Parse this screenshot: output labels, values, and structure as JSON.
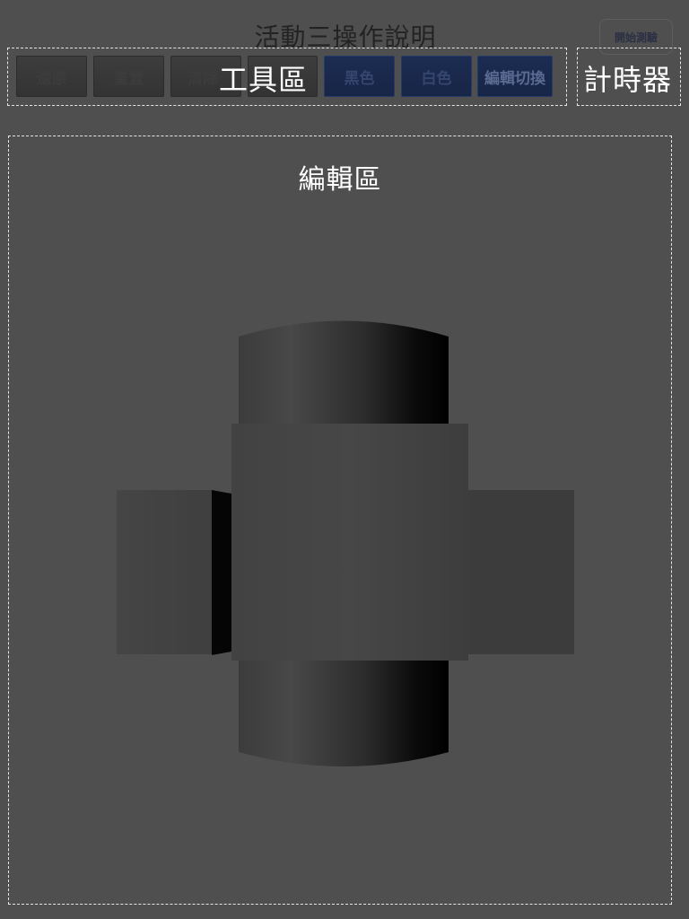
{
  "header": {
    "title": "活動三操作說明",
    "start_button": "開始測驗"
  },
  "toolbar": {
    "label": "工具區",
    "buttons": [
      {
        "label": "還原",
        "state": "disabled"
      },
      {
        "label": "重置",
        "state": "disabled"
      },
      {
        "label": "清除",
        "state": "disabled"
      },
      {
        "label": "",
        "state": "disabled"
      },
      {
        "label": "黑色",
        "state": "enabled"
      },
      {
        "label": "白色",
        "state": "enabled"
      },
      {
        "label": "編輯切換",
        "state": "enabled"
      }
    ]
  },
  "timer": {
    "label": "計時器"
  },
  "editor": {
    "label": "編輯區"
  },
  "colors": {
    "background": "#4f4f4f",
    "dashed_border": "#e6e6e6",
    "button_blue": "#1c2c52"
  }
}
